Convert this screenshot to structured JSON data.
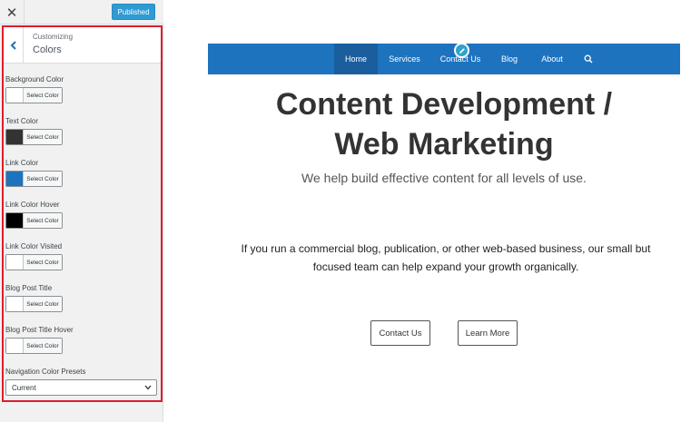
{
  "topbar": {
    "close_glyph": "✕",
    "publish_label": "Published"
  },
  "section": {
    "breadcrumb": "Customizing",
    "title": "Colors"
  },
  "colors": [
    {
      "label": "Background Color",
      "swatch": "#ffffff",
      "button": "Select Color"
    },
    {
      "label": "Text Color",
      "swatch": "#333333",
      "button": "Select Color"
    },
    {
      "label": "Link Color",
      "swatch": "#1e73be",
      "button": "Select Color"
    },
    {
      "label": "Link Color Hover",
      "swatch": "#000000",
      "button": "Select Color"
    },
    {
      "label": "Link Color Visited",
      "swatch": "#ffffff",
      "button": "Select Color"
    },
    {
      "label": "Blog Post Title",
      "swatch": "#ffffff",
      "button": "Select Color"
    },
    {
      "label": "Blog Post Title Hover",
      "swatch": "#ffffff",
      "button": "Select Color"
    }
  ],
  "presets": {
    "label": "Navigation Color Presets",
    "selected": "Current"
  },
  "nav": {
    "items": [
      "Home",
      "Services",
      "Contact Us",
      "Blog",
      "About"
    ],
    "search_icon": "search-icon",
    "bg_color": "#1e73be"
  },
  "hero": {
    "title_line1": "Content Development /",
    "title_line2": "Web Marketing",
    "subtitle": "We help build effective content for all levels of use.",
    "body_line1": "If you run a commercial blog, publication, or other web-based business, our small but",
    "body_line2": "focused team can help expand your growth organically.",
    "btn_contact": "Contact Us",
    "btn_learn": "Learn More"
  }
}
